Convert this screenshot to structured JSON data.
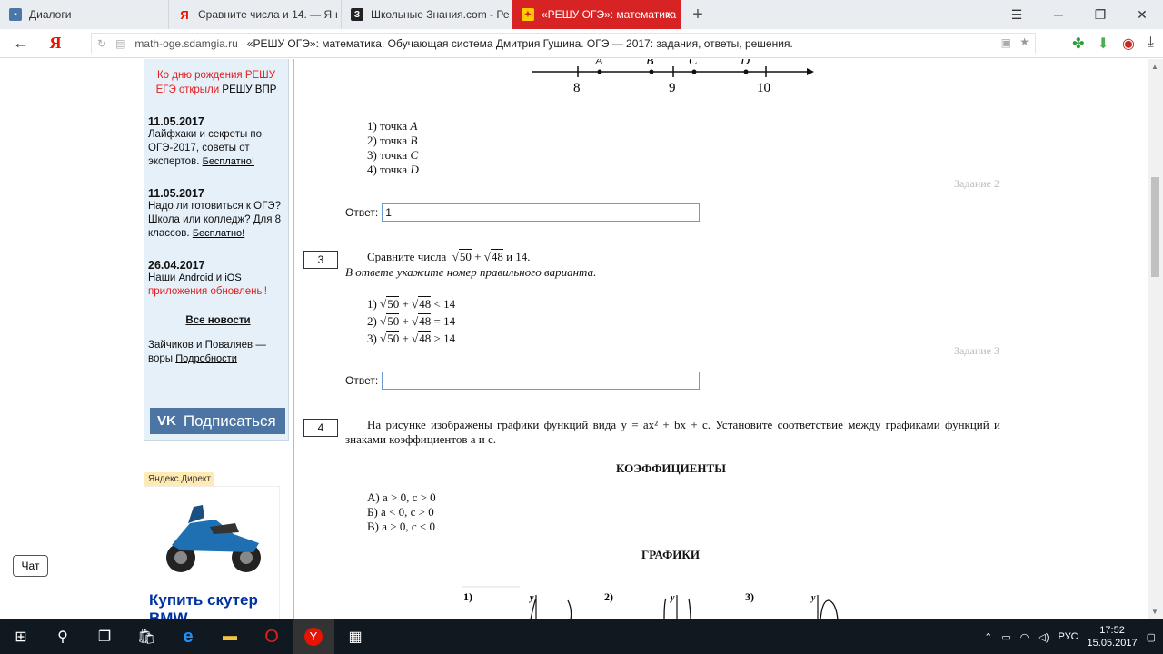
{
  "browser": {
    "tabs": [
      {
        "label": "Диалоги",
        "fav_color": "#4a76a8"
      },
      {
        "label": "Сравните числа и 14. — Ян",
        "fav_color": "#e61400"
      },
      {
        "label": "Школьные Знания.com - Ре",
        "fav_color": "#222222"
      },
      {
        "label": "«РЕШУ ОГЭ»: математика",
        "fav_color": "#ffcc00"
      }
    ],
    "url_domain": "math-oge.sdamgia.ru",
    "url_title": "«РЕШУ ОГЭ»: математика. Обучающая система Дмитрия Гущина. ОГЭ — 2017: задания, ответы, решения."
  },
  "sidebar": {
    "promo_text": "Ко дню рождения РЕШУ ЕГЭ открыли",
    "promo_link": "РЕШУ ВПР",
    "news": [
      {
        "date": "11.05.2017",
        "text": "Лайфхаки и секреты по ОГЭ-2017, советы от экспертов.",
        "link": "Бесплатно!"
      },
      {
        "date": "11.05.2017",
        "text": "Надо ли готовиться к ОГЭ? Школа или колледж? Для 8 классов.",
        "link": "Бесплатно!"
      }
    ],
    "news3": {
      "date": "26.04.2017",
      "pre": "Наши",
      "android": "Android",
      "and": "и",
      "ios": "iOS",
      "red": "приложения обновлены!"
    },
    "all_news": "Все новости",
    "story_text": "Зайчиков и Поваляев — воры",
    "story_link": "Подробности",
    "vk_logo": "VK",
    "vk_label": "Подписаться",
    "direct_label": "Яндекс.Директ",
    "ad_title": "Купить скутер BMW"
  },
  "chat_label": "Чат",
  "main": {
    "numberline": {
      "points": [
        "A",
        "B",
        "C",
        "D"
      ],
      "ticks": [
        "8",
        "9",
        "10"
      ]
    },
    "q2": {
      "options": [
        "1) точка ",
        "2) точка ",
        "3) точка ",
        "4) точка "
      ],
      "letters": [
        "A",
        "B",
        "C",
        "D"
      ],
      "zadanie": "Задание 2",
      "answer_label": "Ответ:",
      "answer_value": "1"
    },
    "q3": {
      "num": "3",
      "text_pre": "Сравните числа",
      "text_and": "и 14.",
      "instruction": "В ответе укажите номер правильного варианта.",
      "opt_nums": [
        "1)",
        "2)",
        "3)"
      ],
      "opt_ops": [
        "<",
        "=",
        ">"
      ],
      "r50": "50",
      "r48": "48",
      "plus": "+",
      "fourteen": "14",
      "zadanie": "Задание 3",
      "answer_label": "Ответ:",
      "answer_value": ""
    },
    "q4": {
      "num": "4",
      "text": "На рисунке изображены графики функций вида y = ax² + bx + c. Установите соответствие между графиками функций и знаками коэффициентов a и c.",
      "coef_heading": "КОЭФФИЦИЕНТЫ",
      "coefs": [
        "А)  a > 0, c > 0",
        "Б)  a < 0, c > 0",
        "В)  a > 0, c < 0"
      ],
      "graphs_heading": "ГРАФИКИ",
      "graph_labels": [
        "1)",
        "2)",
        "3)"
      ],
      "axis_y": "y"
    }
  },
  "taskbar": {
    "lang": "РУС",
    "time": "17:52",
    "date": "15.05.2017"
  }
}
